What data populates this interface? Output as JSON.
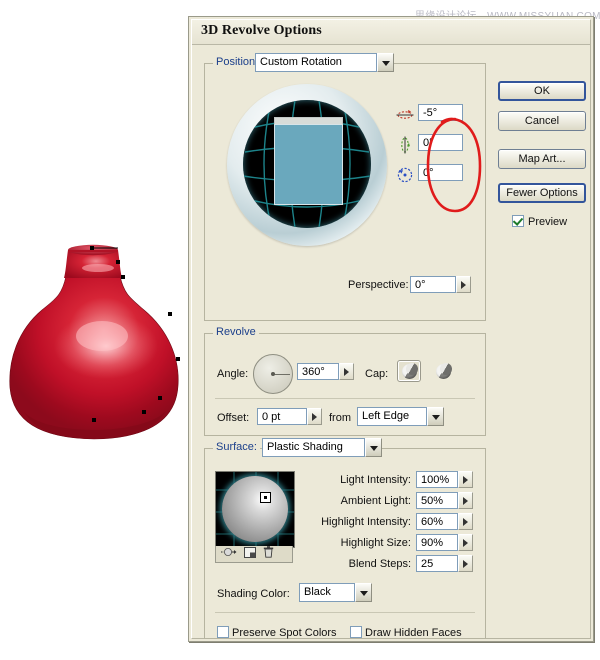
{
  "watermark": "思缘设计论坛—WWW.MISSYUAN.COM",
  "dialog": {
    "title": "3D Revolve Options",
    "buttons": {
      "ok": "OK",
      "cancel": "Cancel",
      "map_art": "Map Art...",
      "fewer_options": "Fewer Options"
    },
    "preview": {
      "label": "Preview",
      "checked": true
    }
  },
  "position": {
    "legend": "Position:",
    "preset": "Custom Rotation",
    "rotation": {
      "x_axis": {
        "icon": "rotate-x-icon",
        "value": "-5°",
        "color": "#c0392b"
      },
      "y_axis": {
        "icon": "rotate-y-icon",
        "value": "0°",
        "color": "#4e9a2f"
      },
      "z_axis": {
        "icon": "rotate-z-icon",
        "value": "0°",
        "color": "#2a4fc4"
      }
    },
    "perspective": {
      "label": "Perspective:",
      "value": "0°"
    }
  },
  "revolve": {
    "legend": "Revolve",
    "angle": {
      "label": "Angle:",
      "value": "360°"
    },
    "cap": {
      "label": "Cap:",
      "selected": 0
    },
    "offset": {
      "label": "Offset:",
      "value": "0 pt"
    },
    "from": {
      "label": "from",
      "value": "Left Edge"
    }
  },
  "surface": {
    "legend": "Surface:",
    "shading": "Plastic Shading",
    "light_tools": [
      "new-light-icon",
      "move-light-back-icon",
      "delete-light-icon"
    ],
    "fields": [
      {
        "label": "Light Intensity:",
        "value": "100%"
      },
      {
        "label": "Ambient Light:",
        "value": "50%"
      },
      {
        "label": "Highlight Intensity:",
        "value": "60%"
      },
      {
        "label": "Highlight Size:",
        "value": "90%"
      },
      {
        "label": "Blend Steps:",
        "value": "25"
      }
    ],
    "shading_color": {
      "label": "Shading Color:",
      "value": "Black"
    },
    "checkboxes": [
      {
        "label": "Preserve Spot Colors",
        "checked": false
      },
      {
        "label": "Draw Hidden Faces",
        "checked": false
      }
    ]
  },
  "artwork": {
    "name": "red-revolved-vase",
    "colors": {
      "base": "#c8102e",
      "highlight": "#f08a90",
      "shadow": "#7a0a18"
    }
  },
  "annotation": {
    "shape": "ellipse",
    "color": "#e01b1b"
  }
}
